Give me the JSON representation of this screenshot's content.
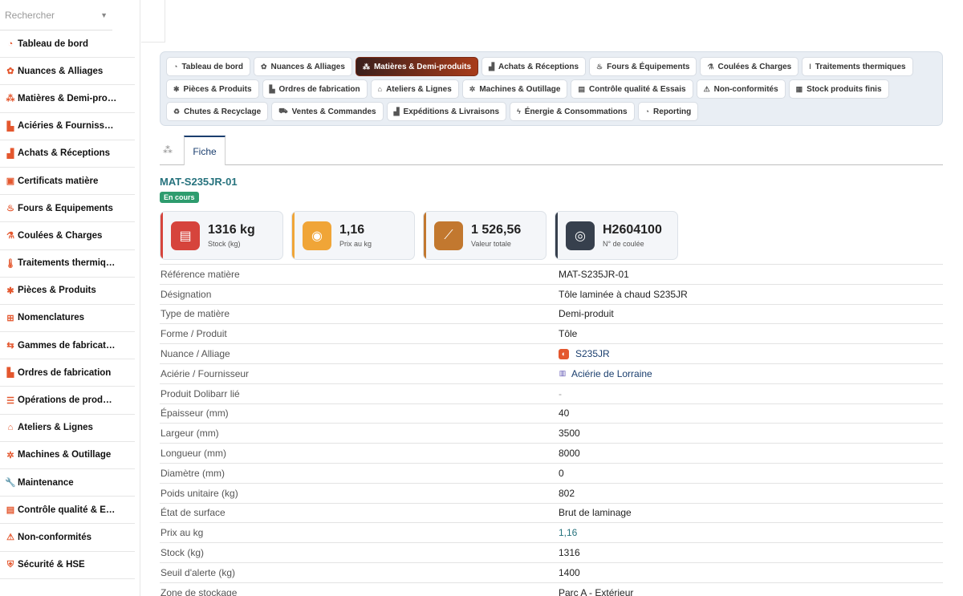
{
  "sidebar": {
    "search_placeholder": "Rechercher",
    "items": [
      {
        "label": "Tableau de bord",
        "icon": "dashboard-icon",
        "glyph": "◔"
      },
      {
        "label": "Nuances & Alliages",
        "icon": "cog-icon",
        "glyph": "✿"
      },
      {
        "label": "Matières & Demi-pro…",
        "icon": "cubes-icon",
        "glyph": "⁂"
      },
      {
        "label": "Aciéries & Fournisse…",
        "icon": "industry-icon",
        "glyph": "▙"
      },
      {
        "label": "Achats & Réceptions",
        "icon": "truck-icon",
        "glyph": "▟"
      },
      {
        "label": "Certificats matière",
        "icon": "certificate-icon",
        "glyph": "▣"
      },
      {
        "label": "Fours & Équipements",
        "icon": "fire-icon",
        "glyph": "♨"
      },
      {
        "label": "Coulées & Charges",
        "icon": "flask-icon",
        "glyph": "⚗"
      },
      {
        "label": "Traitements thermiq…",
        "icon": "thermometer-icon",
        "glyph": "🌡"
      },
      {
        "label": "Pièces & Produits",
        "icon": "gear-icon",
        "glyph": "✱"
      },
      {
        "label": "Nomenclatures",
        "icon": "sitemap-icon",
        "glyph": "⊞"
      },
      {
        "label": "Gammes de fabricati…",
        "icon": "route-icon",
        "glyph": "⇆"
      },
      {
        "label": "Ordres de fabrication",
        "icon": "factory-icon",
        "glyph": "▙"
      },
      {
        "label": "Opérations de produ…",
        "icon": "list-icon",
        "glyph": "☰"
      },
      {
        "label": "Ateliers & Lignes",
        "icon": "warehouse-icon",
        "glyph": "⌂"
      },
      {
        "label": "Machines & Outillage",
        "icon": "cogs-icon",
        "glyph": "✲"
      },
      {
        "label": "Maintenance",
        "icon": "wrench-icon",
        "glyph": "🔧"
      },
      {
        "label": "Contrôle qualité & E…",
        "icon": "clipboard-icon",
        "glyph": "▤"
      },
      {
        "label": "Non-conformités",
        "icon": "warning-icon",
        "glyph": "⚠"
      },
      {
        "label": "Sécurité & HSE",
        "icon": "shield-icon",
        "glyph": "⛨"
      }
    ]
  },
  "tabs": {
    "rows": [
      [
        {
          "label": "Tableau de bord",
          "icon": "dashboard-icon",
          "glyph": "◔"
        },
        {
          "label": "Nuances & Alliages",
          "icon": "cog-icon",
          "glyph": "✿"
        },
        {
          "label": "Matières & Demi-produits",
          "icon": "cubes-icon",
          "glyph": "⁂",
          "active": true
        },
        {
          "label": "Achats & Réceptions",
          "icon": "truck-icon",
          "glyph": "▟"
        },
        {
          "label": "Fours & Équipements",
          "icon": "fire-icon",
          "glyph": "♨"
        },
        {
          "label": "Coulées & Charges",
          "icon": "flask-icon",
          "glyph": "⚗"
        },
        {
          "label": "Traitements thermiques",
          "icon": "thermometer-icon",
          "glyph": "ǀ"
        }
      ],
      [
        {
          "label": "Pièces & Produits",
          "icon": "gear-icon",
          "glyph": "✱"
        },
        {
          "label": "Ordres de fabrication",
          "icon": "factory-icon",
          "glyph": "▙"
        },
        {
          "label": "Ateliers & Lignes",
          "icon": "warehouse-icon",
          "glyph": "⌂"
        },
        {
          "label": "Machines & Outillage",
          "icon": "cogs-icon",
          "glyph": "✲"
        },
        {
          "label": "Contrôle qualité & Essais",
          "icon": "clipboard-icon",
          "glyph": "▤"
        },
        {
          "label": "Non-conformités",
          "icon": "warning-icon",
          "glyph": "⚠"
        },
        {
          "label": "Stock produits finis",
          "icon": "box-icon",
          "glyph": "▦"
        }
      ],
      [
        {
          "label": "Chutes & Recyclage",
          "icon": "recycle-icon",
          "glyph": "♻"
        },
        {
          "label": "Ventes & Commandes",
          "icon": "cart-icon",
          "glyph": "⛟"
        },
        {
          "label": "Expéditions & Livraisons",
          "icon": "truck-icon",
          "glyph": "▟"
        },
        {
          "label": "Énergie & Consommations",
          "icon": "bolt-icon",
          "glyph": "ϟ"
        },
        {
          "label": "Reporting",
          "icon": "chart-pie-icon",
          "glyph": "◔"
        }
      ]
    ]
  },
  "subtabs": {
    "fiche": "Fiche"
  },
  "record": {
    "ref": "MAT-S235JR-01",
    "status": "En cours"
  },
  "kpis": [
    {
      "value": "1316 kg",
      "label": "Stock (kg)",
      "icon": "warehouse-icon",
      "glyph": "▤",
      "color": "#d6443c",
      "bar": "#d6443c"
    },
    {
      "value": "1,16",
      "label": "Prix au kg",
      "icon": "coins-icon",
      "glyph": "◉",
      "color": "#f0a537",
      "bar": "#f0a537"
    },
    {
      "value": "1 526,56",
      "label": "Valeur totale",
      "icon": "chart-line-icon",
      "glyph": "⟋",
      "color": "#c2782f",
      "bar": "#c2782f"
    },
    {
      "value": "H2604100",
      "label": "N° de coulée",
      "icon": "fingerprint-icon",
      "glyph": "◎",
      "color": "#37404d",
      "bar": "#37404d"
    }
  ],
  "details": [
    {
      "label": "Référence matière",
      "value": "MAT-S235JR-01",
      "style": ""
    },
    {
      "label": "Désignation",
      "value": "Tôle laminée à chaud S235JR",
      "style": ""
    },
    {
      "label": "Type de matière",
      "value": "Demi-produit",
      "style": ""
    },
    {
      "label": "Forme / Produit",
      "value": "Tôle",
      "style": ""
    },
    {
      "label": "Nuance / Alliage",
      "value": "S235JR",
      "style": "link",
      "icon": "alloy-icon"
    },
    {
      "label": "Aciérie / Fournisseur",
      "value": "Aciérie de Lorraine",
      "style": "link",
      "icon": "building-icon"
    },
    {
      "label": "Produit Dolibarr lié",
      "value": "-",
      "style": "dash"
    },
    {
      "label": "Épaisseur (mm)",
      "value": "40",
      "style": ""
    },
    {
      "label": "Largeur (mm)",
      "value": "3500",
      "style": ""
    },
    {
      "label": "Longueur (mm)",
      "value": "8000",
      "style": ""
    },
    {
      "label": "Diamètre (mm)",
      "value": "0",
      "style": ""
    },
    {
      "label": "Poids unitaire (kg)",
      "value": "802",
      "style": ""
    },
    {
      "label": "État de surface",
      "value": "Brut de laminage",
      "style": ""
    },
    {
      "label": "Prix au kg",
      "value": "1,16",
      "style": "teal"
    },
    {
      "label": "Stock (kg)",
      "value": "1316",
      "style": ""
    },
    {
      "label": "Seuil d'alerte (kg)",
      "value": "1400",
      "style": ""
    },
    {
      "label": "Zone de stockage",
      "value": "Parc A - Extérieur",
      "style": ""
    }
  ]
}
